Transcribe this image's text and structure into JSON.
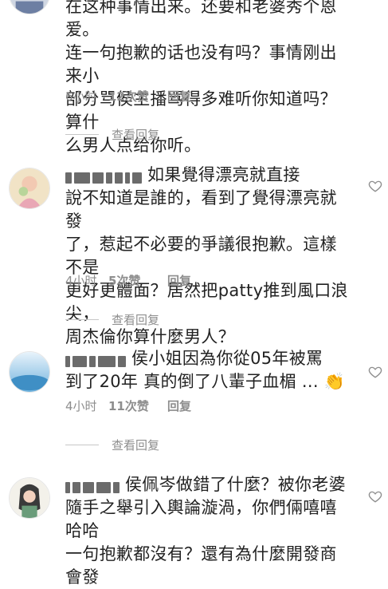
{
  "comments": [
    {
      "id": "c0",
      "lines": [
        "在这种事情出来。还要和老婆秀个恩爱。",
        "连一句抱歉的话也没有吗？事情刚出来小",
        "部分骂侯主播骂得多难听你知道吗？算什",
        "么男人点给你听。"
      ],
      "time": "6小时",
      "likes": "12次赞",
      "reply": "回复",
      "view_replies": "查看回复"
    },
    {
      "id": "c1",
      "lines": [
        "如果覺得漂亮就直接",
        "說不知道是誰的，看到了覺得漂亮就發",
        "了，惹起不必要的爭議很抱歉。這樣不是",
        "更好更體面？居然把patty推到風口浪尖，",
        "周杰倫你算什麼男人？"
      ],
      "time": "4小时",
      "likes": "5次赞",
      "reply": "回复",
      "view_replies": "查看回复"
    },
    {
      "id": "c2",
      "lines": [
        "侯小姐因為你從05年被罵",
        "到了20年 真的倒了八輩子血楣 ... 👏"
      ],
      "time": "4小时",
      "likes": "11次赞",
      "reply": "回复",
      "view_replies": "查看回复"
    },
    {
      "id": "c3",
      "lines": [
        "侯佩岑做錯了什麼？被你老婆",
        "隨手之舉引入輿論漩渦，你們倆嘻嘻哈哈",
        "一句抱歉都沒有？還有為什麼開發商會發"
      ]
    }
  ],
  "icons": {
    "like": "heart-outline-icon"
  },
  "colors": {
    "meta": "#8e8e8e",
    "text": "#222222",
    "divider": "#c7c7c7"
  }
}
